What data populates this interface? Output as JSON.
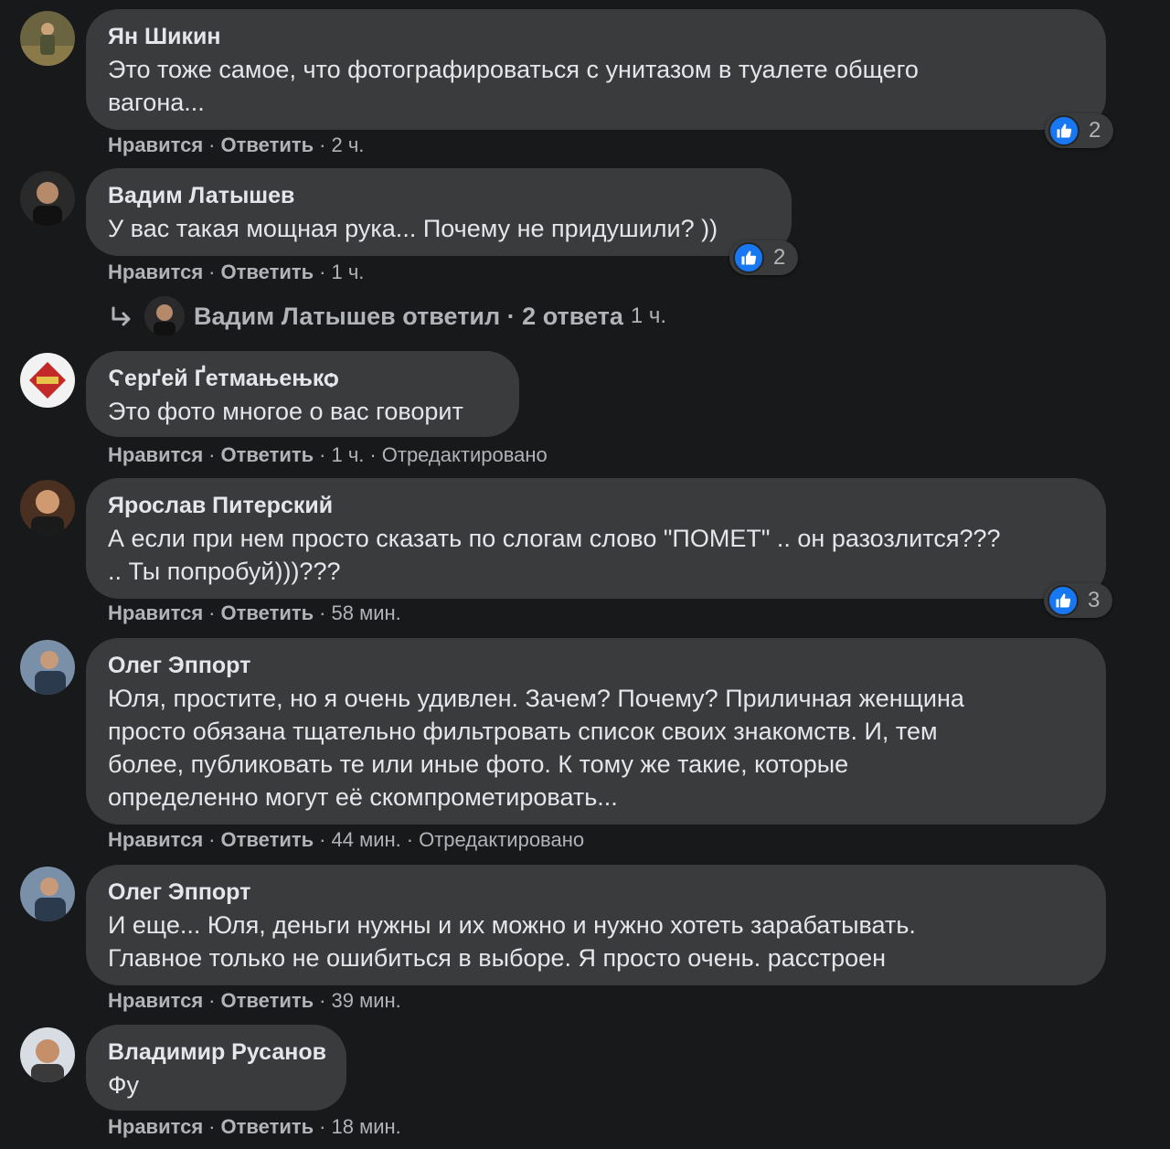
{
  "colors": {
    "background": "#18191a",
    "bubble": "#3a3b3c",
    "text": "#e4e6eb",
    "secondary_text": "#b0b3b8",
    "like_blue": "#1877f2"
  },
  "comments": [
    {
      "author": "Ян Шикин",
      "text": "Это тоже самое, что фотографироваться с унитазом в туалете общего\nвагона...",
      "like_label": "Нравится",
      "reply_label": "Ответить",
      "time": "2 ч.",
      "reaction_icon": "like-icon",
      "reactions": "2"
    },
    {
      "author": "Вадим Латышев",
      "text": "У вас такая мощная рука... Почему не придушили? ))",
      "like_label": "Нравится",
      "reply_label": "Ответить",
      "time": "1 ч.",
      "reaction_icon": "like-icon",
      "reactions": "2",
      "replies": {
        "text": "Вадим Латышев ответил · 2 ответа",
        "time": "1 ч."
      }
    },
    {
      "author": "Ϛерґей Ґетмањењкѻ",
      "text": "Это фото многое о вас говорит",
      "like_label": "Нравится",
      "reply_label": "Ответить",
      "time": "1 ч.",
      "edited": "Отредактировано"
    },
    {
      "author": "Ярослав Питерский",
      "text": "А если при нем просто сказать по слогам слово \"ПОМЕТ\" .. он разозлится???\n.. Ты попробуй)))???",
      "like_label": "Нравится",
      "reply_label": "Ответить",
      "time": "58 мин.",
      "reaction_icon": "like-icon",
      "reactions": "3"
    },
    {
      "author": "Олег Эппорт",
      "text": "Юля, простите, но я очень удивлен. Зачем? Почему? Приличная женщина\nпросто обязана тщательно фильтровать список своих знакомств. И, тем\nболее, публиковать те или иные фото. К тому же такие, которые\nопределенно могут её скомпрометировать...",
      "like_label": "Нравится",
      "reply_label": "Ответить",
      "time": "44 мин.",
      "edited": "Отредактировано"
    },
    {
      "author": "Олег Эппорт",
      "text": "И еще... Юля, деньги нужны и их можно и нужно хотеть зарабатывать.\nГлавное только не ошибиться в выборе. Я просто очень. расстроен",
      "like_label": "Нравится",
      "reply_label": "Ответить",
      "time": "39 мин."
    },
    {
      "author": "Владимир Русанов",
      "text": "Фу",
      "like_label": "Нравится",
      "reply_label": "Ответить",
      "time": "18 мин."
    }
  ]
}
